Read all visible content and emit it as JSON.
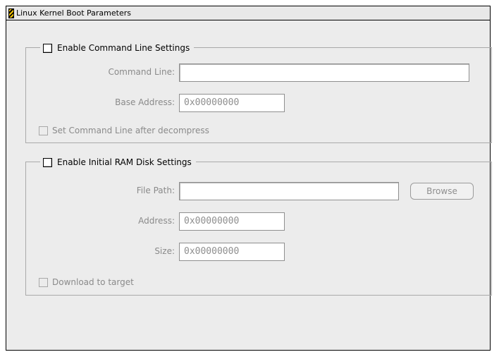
{
  "window": {
    "title": "Linux Kernel Boot Parameters"
  },
  "command_line_settings": {
    "section_label": "Enable Command Line Settings",
    "command_line_label": "Command Line:",
    "command_line_value": "",
    "base_address_label": "Base Address:",
    "base_address_value": "0x00000000",
    "decompress_label": "Set Command Line after decompress"
  },
  "ram_disk_settings": {
    "section_label": "Enable Initial RAM Disk Settings",
    "file_path_label": "File Path:",
    "file_path_value": "",
    "browse_label": "Browse",
    "address_label": "Address:",
    "address_value": "0x00000000",
    "size_label": "Size:",
    "size_value": "0x00000000",
    "download_label": "Download to target"
  },
  "icons": {
    "window_icon": "window-icon",
    "checkbox_icon": "checkbox-icon"
  },
  "colors": {
    "window_background": "#ececec",
    "disabled_text": "#8a8a8a",
    "border": "#a9a9a9",
    "accent_stripe_yellow": "#f5c400"
  }
}
